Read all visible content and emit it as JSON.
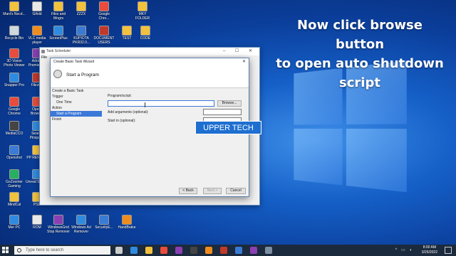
{
  "caption": {
    "line1": "Now click browse button",
    "line2": "to open auto shutdown script"
  },
  "watermark": "UPPER TECH",
  "desktop_icons": [
    {
      "label": "Mani's Necd..."
    },
    {
      "label": "Gifold"
    },
    {
      "label": "Files and Mngrs"
    },
    {
      "label": "ZZZX"
    },
    {
      "label": "Google Chro..."
    },
    {
      "label": "MKY FOLDER"
    },
    {
      "label": "Recycle Bin"
    },
    {
      "label": "VLC media player"
    },
    {
      "label": "ScreenPlus"
    },
    {
      "label": "KUPIOTA PKR32.0..."
    },
    {
      "label": "DOCUMENT USERS"
    },
    {
      "label": "TEST"
    },
    {
      "label": "CODE"
    },
    {
      "label": "3D Vision Photo Viewer"
    },
    {
      "label": "Adobe Premiere..."
    },
    {
      "label": "Snapper Pro"
    },
    {
      "label": "Filezilla"
    },
    {
      "label": "Google Chrome"
    },
    {
      "label": "Opera Browser"
    },
    {
      "label": "MediaCCO"
    },
    {
      "label": "Search Pinspace"
    },
    {
      "label": "Openshot"
    },
    {
      "label": "PP RENAME"
    },
    {
      "label": "GoZoomer Gaming"
    },
    {
      "label": "Unreal Screen"
    },
    {
      "label": "MindCal"
    },
    {
      "label": "PSD"
    },
    {
      "label": "Mer PC"
    },
    {
      "label": "ROM"
    },
    {
      "label": "WindowsGrid Stop Remover"
    },
    {
      "label": "Windows Ad Remover"
    },
    {
      "label": "SecurityE..."
    },
    {
      "label": "HandBrake"
    }
  ],
  "task_scheduler": {
    "title": "Task Scheduler",
    "menu_file": "File",
    "controls": "–  ☐  ✕"
  },
  "wizard": {
    "title": "Create Basic Task Wizard",
    "close": "✕",
    "header": "Start a Program",
    "steps": [
      {
        "label": "Create a Basic Task",
        "indent": false,
        "active": false
      },
      {
        "label": "Trigger",
        "indent": false,
        "active": false
      },
      {
        "label": "One Time",
        "indent": true,
        "active": false
      },
      {
        "label": "Action",
        "indent": false,
        "active": false
      },
      {
        "label": "Start a Program",
        "indent": true,
        "active": true
      },
      {
        "label": "Finish",
        "indent": false,
        "active": false
      }
    ],
    "program_label": "Program/script:",
    "program_value": "",
    "browse": "Browse...",
    "args_label": "Add arguments (optional):",
    "args_value": "",
    "start_in_label": "Start in (optional):",
    "start_in_value": "",
    "back": "< Back",
    "next": "Next >",
    "cancel": "Cancel"
  },
  "taskbar": {
    "search_placeholder": "Type here to search",
    "apps": [
      {
        "name": "task-view-icon",
        "color": "#cccccc"
      },
      {
        "name": "edge-icon",
        "color": "#2f8be0"
      },
      {
        "name": "explorer-icon",
        "color": "#f2c13d"
      },
      {
        "name": "chrome-icon",
        "color": "#e74c3c"
      },
      {
        "name": "premiere-icon",
        "color": "#8a3fb3"
      },
      {
        "name": "obs-icon",
        "color": "#444444"
      },
      {
        "name": "vlc-icon",
        "color": "#f08c1e"
      },
      {
        "name": "filezilla-icon",
        "color": "#c0392b"
      },
      {
        "name": "photos-icon",
        "color": "#3a7bd5"
      },
      {
        "name": "premiere2-icon",
        "color": "#8a3fb3"
      },
      {
        "name": "scheduler-icon",
        "color": "#7d8ea3"
      }
    ],
    "time": "8:00 AM",
    "date": "3/26/2022"
  }
}
